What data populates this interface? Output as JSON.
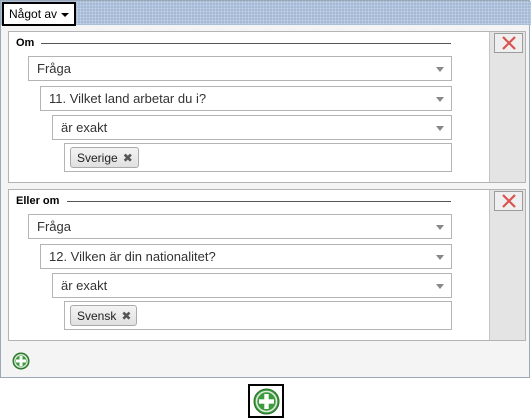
{
  "match_select": {
    "value": "Något av"
  },
  "conditions": [
    {
      "title": "Om",
      "field_select": "Fråga",
      "question_select": "11. Vilket land arbetar du i?",
      "operator_select": "är exakt",
      "tag": "Sverige",
      "tag_remove": "✖"
    },
    {
      "title": "Eller om",
      "field_select": "Fråga",
      "question_select": "12. Vilken är din nationalitet?",
      "operator_select": "är exakt",
      "tag": "Svensk",
      "tag_remove": "✖"
    }
  ],
  "icons": {
    "remove": "close-icon",
    "add": "plus-circle-icon",
    "dropdown": "chevron-down-icon"
  },
  "colors": {
    "remove_x": "#d9534f",
    "add_green": "#3c9b3c",
    "header_blue": "#9cb4d2"
  }
}
